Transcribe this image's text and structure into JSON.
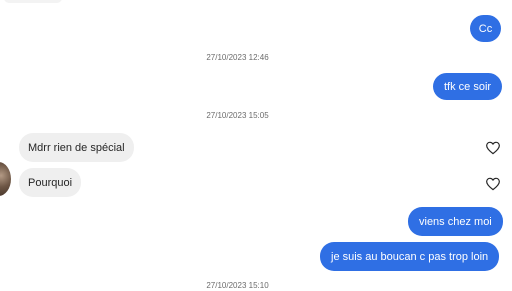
{
  "messages": {
    "sent_1": "Cc",
    "sent_2": "tfk ce soir",
    "received_1": "Mdrr rien de spécial",
    "received_2": "Pourquoi",
    "sent_3": "viens chez moi",
    "sent_4": "je suis au boucan c pas trop loin"
  },
  "timestamps": {
    "t1": "27/10/2023 12:46",
    "t2": "27/10/2023 15:05",
    "t3": "27/10/2023 15:10"
  },
  "colors": {
    "sent_bubble": "#2f6fe4",
    "received_bubble": "#efefef",
    "timestamp_text": "#6b6b6b"
  },
  "icons": {
    "like": "heart-outline-icon"
  }
}
